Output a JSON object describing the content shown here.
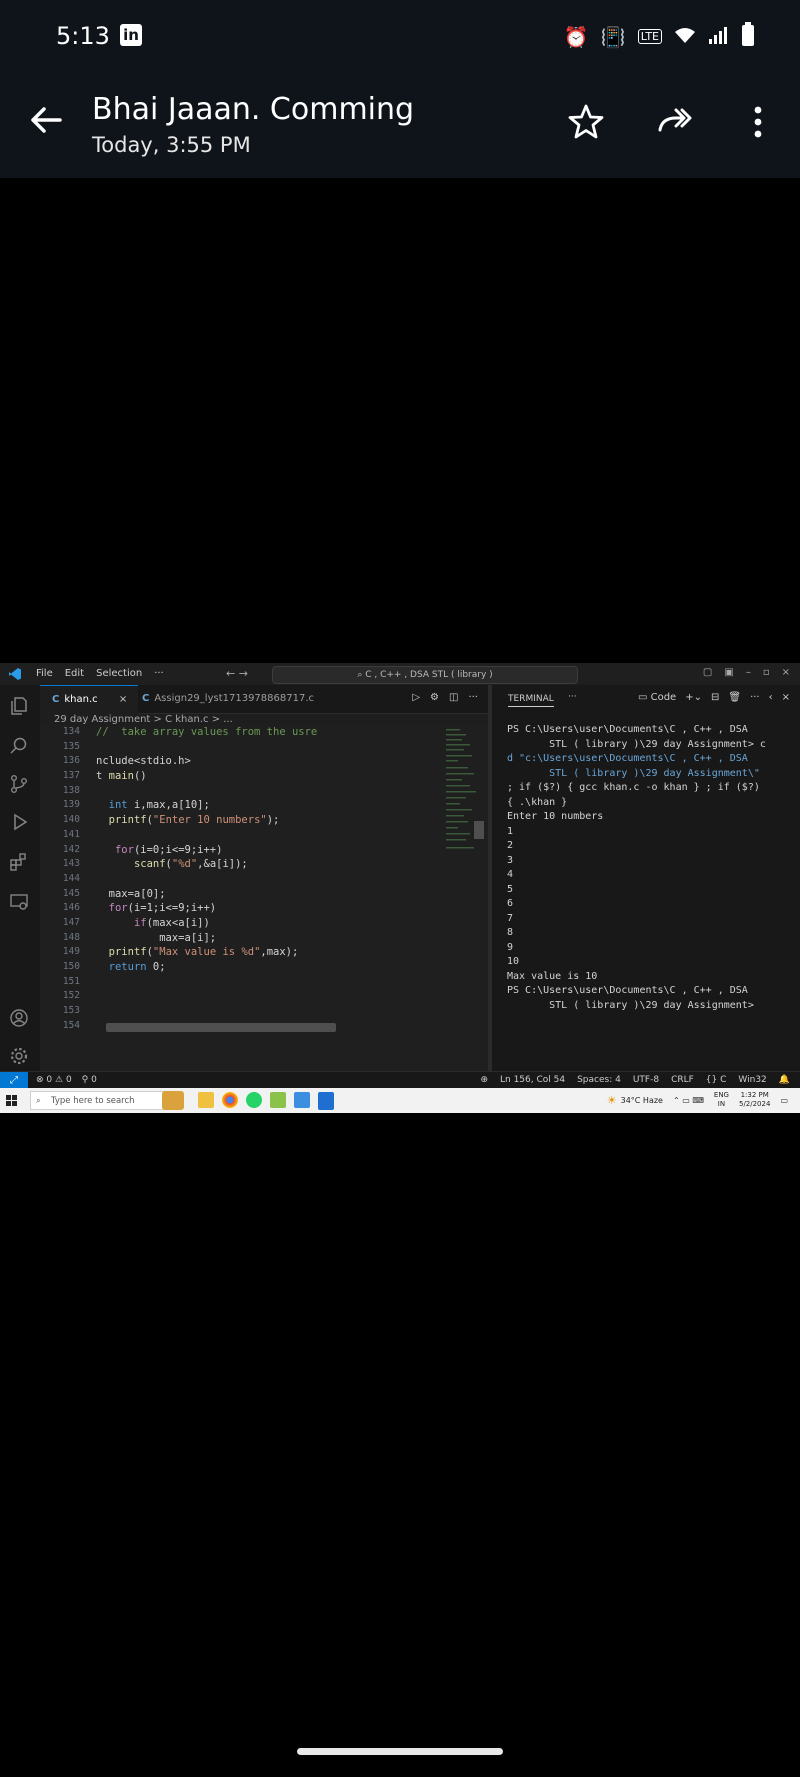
{
  "status_bar": {
    "time": "5:13",
    "app_badge": "in",
    "net_label": "LTE"
  },
  "app_bar": {
    "title": "Bhai Jaaan. Comming",
    "subtitle": "Today, 3:55 PM"
  },
  "vscode": {
    "menu": [
      "File",
      "Edit",
      "Selection",
      "···"
    ],
    "command_center": "C , C++ , DSA STL ( library )",
    "tabs": [
      {
        "label": "khan.c",
        "active": true
      },
      {
        "label": "Assign29_lyst1713978868717.c",
        "active": false
      }
    ],
    "breadcrumb": "29 day Assignment > C khan.c > ...",
    "editor": {
      "line_numbers": [
        "134",
        "135",
        "136",
        "137",
        "138",
        "139",
        "140",
        "141",
        "142",
        "143",
        "144",
        "145",
        "146",
        "147",
        "148",
        "149",
        "150",
        "151",
        "152",
        "153",
        "154"
      ],
      "code_lines": [
        "//  take array values from the usre",
        "",
        "nclude<stdio.h>",
        "t main()",
        "",
        "  int i,max,a[10];",
        "  printf(\"Enter 10 numbers\");",
        "",
        "   for(i=0;i<=9;i++)",
        "      scanf(\"%d\",&a[i]);",
        "",
        "  max=a[0];",
        "  for(i=1;i<=9;i++)",
        "      if(max<a[i])",
        "          max=a[i];",
        "  printf(\"Max value is %d\",max);",
        "  return 0;",
        "",
        "",
        "",
        ""
      ]
    },
    "terminal": {
      "tab": "TERMINAL",
      "shell": "Code",
      "lines": [
        "PS C:\\Users\\user\\Documents\\C , C++ , DSA",
        "       STL ( library )\\29 day Assignment> c",
        "d \"c:\\Users\\user\\Documents\\C , C++ , DSA",
        "       STL ( library )\\29 day Assignment\\\"",
        "; if ($?) { gcc khan.c -o khan } ; if ($?)",
        "{ .\\khan }",
        "Enter 10 numbers",
        "1",
        "2",
        "3",
        "4",
        "5",
        "6",
        "7",
        "8",
        "9",
        "10",
        "Max value is 10",
        "PS C:\\Users\\user\\Documents\\C , C++ , DSA",
        "       STL ( library )\\29 day Assignment>"
      ]
    },
    "status": {
      "errors": "0",
      "warnings": "0",
      "ports": "0",
      "position": "Ln 156, Col 54",
      "spaces": "Spaces: 4",
      "encoding": "UTF-8",
      "eol": "CRLF",
      "language": "C",
      "config": "Win32"
    }
  },
  "taskbar": {
    "search_placeholder": "Type here to search",
    "weather": "34°C  Haze",
    "lang_top": "ENG",
    "lang_bottom": "IN",
    "clock_time": "1:32 PM",
    "clock_date": "5/2/2024"
  }
}
